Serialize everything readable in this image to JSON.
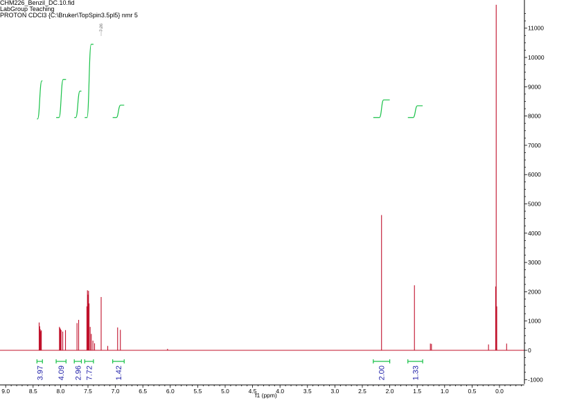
{
  "header": {
    "line1": "CHM226_Benzil_DC.10.fid",
    "line2": "LabGroup Teaching",
    "line3": "PROTON CDCl3 {C:\\Bruker\\TopSpin3.5pl5} nmr 5"
  },
  "colors": {
    "spectrum": "#c0102a",
    "integral_curve": "#17c147",
    "integral_bracket": "#17c147",
    "integral_text": "#1f1fa8",
    "axis": "#000000"
  },
  "chart_data": {
    "type": "line",
    "title": "",
    "xlabel": "f1 (ppm)",
    "ylabel": "",
    "x_reversed": true,
    "xlim": [
      9.0,
      -0.45
    ],
    "ylim": [
      -1150,
      11800
    ],
    "x_ticks": [
      {
        "value": 9.0,
        "label": "9.0"
      },
      {
        "value": 8.5,
        "label": "8.5"
      },
      {
        "value": 8.0,
        "label": "8.0"
      },
      {
        "value": 7.5,
        "label": "7.5"
      },
      {
        "value": 7.0,
        "label": "7.0"
      },
      {
        "value": 6.5,
        "label": "6.5"
      },
      {
        "value": 6.0,
        "label": "6.0"
      },
      {
        "value": 5.5,
        "label": "5.5"
      },
      {
        "value": 5.0,
        "label": "5.0"
      },
      {
        "value": 4.5,
        "label": "4.5"
      },
      {
        "value": 4.0,
        "label": "4.0"
      },
      {
        "value": 3.5,
        "label": "3.5"
      },
      {
        "value": 3.0,
        "label": "3.0"
      },
      {
        "value": 2.5,
        "label": "2.5"
      },
      {
        "value": 2.0,
        "label": "2.0"
      },
      {
        "value": 1.5,
        "label": "1.5"
      },
      {
        "value": 1.0,
        "label": "1.0"
      },
      {
        "value": 0.5,
        "label": "0.5"
      },
      {
        "value": 0.0,
        "label": "0.0"
      }
    ],
    "y_ticks": [
      {
        "value": 11000,
        "label": "11000"
      },
      {
        "value": 10000,
        "label": "10000"
      },
      {
        "value": 9000,
        "label": "9000"
      },
      {
        "value": 8000,
        "label": "8000"
      },
      {
        "value": 7000,
        "label": "7000"
      },
      {
        "value": 6000,
        "label": "6000"
      },
      {
        "value": 5000,
        "label": "5000"
      },
      {
        "value": 4000,
        "label": "4000"
      },
      {
        "value": 3000,
        "label": "3000"
      },
      {
        "value": 2000,
        "label": "2000"
      },
      {
        "value": 1000,
        "label": "1000"
      },
      {
        "value": 0,
        "label": "0"
      },
      {
        "value": -1000,
        "label": "-1000"
      }
    ],
    "peak_label": {
      "value": 7.26,
      "text": "7.26"
    },
    "peaks": [
      {
        "ppm": 8.39,
        "height": 950
      },
      {
        "ppm": 8.38,
        "height": 820
      },
      {
        "ppm": 8.37,
        "height": 720
      },
      {
        "ppm": 8.36,
        "height": 650
      },
      {
        "ppm": 8.35,
        "height": 680
      },
      {
        "ppm": 8.02,
        "height": 800
      },
      {
        "ppm": 8.01,
        "height": 760
      },
      {
        "ppm": 8.0,
        "height": 720
      },
      {
        "ppm": 7.99,
        "height": 690
      },
      {
        "ppm": 7.96,
        "height": 640
      },
      {
        "ppm": 7.91,
        "height": 690
      },
      {
        "ppm": 7.7,
        "height": 930
      },
      {
        "ppm": 7.67,
        "height": 1040
      },
      {
        "ppm": 7.52,
        "height": 1500
      },
      {
        "ppm": 7.51,
        "height": 2050
      },
      {
        "ppm": 7.5,
        "height": 1900
      },
      {
        "ppm": 7.49,
        "height": 2030
      },
      {
        "ppm": 7.48,
        "height": 1600
      },
      {
        "ppm": 7.46,
        "height": 800
      },
      {
        "ppm": 7.44,
        "height": 560
      },
      {
        "ppm": 7.41,
        "height": 330
      },
      {
        "ppm": 7.38,
        "height": 240
      },
      {
        "ppm": 7.26,
        "height": 1820
      },
      {
        "ppm": 7.14,
        "height": 150
      },
      {
        "ppm": 6.96,
        "height": 780
      },
      {
        "ppm": 6.91,
        "height": 700
      },
      {
        "ppm": 6.05,
        "height": 50
      },
      {
        "ppm": 2.15,
        "height": 4620
      },
      {
        "ppm": 1.55,
        "height": 2220
      },
      {
        "ppm": 1.26,
        "height": 230
      },
      {
        "ppm": 1.24,
        "height": 220
      },
      {
        "ppm": 0.2,
        "height": 200
      },
      {
        "ppm": 0.07,
        "height": 2180
      },
      {
        "ppm": 0.06,
        "height": 11800
      },
      {
        "ppm": 0.05,
        "height": 1500
      },
      {
        "ppm": -0.13,
        "height": 230
      }
    ],
    "integrals": [
      {
        "from": 8.43,
        "to": 8.33,
        "value": "3.97",
        "curve": {
          "y_start": 7900,
          "y_end": 9200
        }
      },
      {
        "from": 8.08,
        "to": 7.9,
        "value": "4.09",
        "curve": {
          "y_start": 7950,
          "y_end": 9250
        }
      },
      {
        "from": 7.75,
        "to": 7.62,
        "value": "2.96",
        "curve": {
          "y_start": 7950,
          "y_end": 8850
        }
      },
      {
        "from": 7.56,
        "to": 7.4,
        "value": "7.72",
        "curve": {
          "y_start": 7950,
          "y_end": 10450
        }
      },
      {
        "from": 7.05,
        "to": 6.84,
        "value": "1.42",
        "curve": {
          "y_start": 7950,
          "y_end": 8370
        }
      },
      {
        "from": 2.3,
        "to": 2.0,
        "value": "2.00",
        "curve": {
          "y_start": 7950,
          "y_end": 8550
        }
      },
      {
        "from": 1.67,
        "to": 1.4,
        "value": "1.33",
        "curve": {
          "y_start": 7950,
          "y_end": 8350
        }
      }
    ]
  }
}
